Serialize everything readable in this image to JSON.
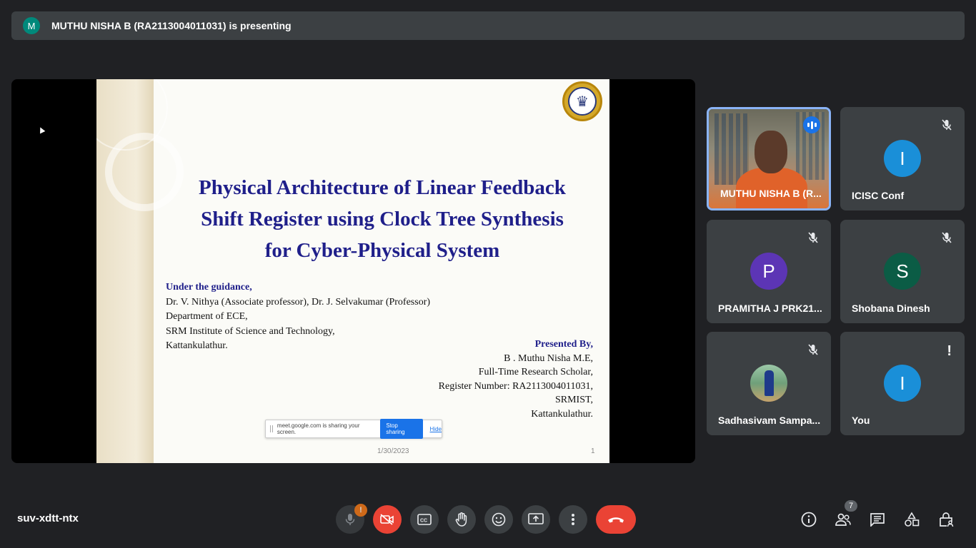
{
  "banner": {
    "avatar_letter": "M",
    "text": "MUTHU NISHA B (RA2113004011031) is presenting"
  },
  "slide": {
    "title_lines": [
      "Physical Architecture of Linear Feedback",
      "Shift Register using Clock Tree Synthesis",
      "for Cyber-Physical System"
    ],
    "guidance": {
      "heading": "Under the guidance,",
      "lines": [
        "Dr. V. Nithya (Associate professor), Dr. J. Selvakumar (Professor)",
        "Department of ECE,",
        "SRM Institute of Science and Technology,",
        "Kattankulathur."
      ]
    },
    "presenter": {
      "heading": "Presented By,",
      "lines": [
        "B . Muthu Nisha M.E,",
        "Full-Time Research Scholar,",
        "Register Number: RA2113004011031,",
        "SRMIST,",
        "Kattankulathur."
      ]
    },
    "share_bar": {
      "text": "meet.google.com is sharing your screen.",
      "stop_label": "Stop sharing",
      "hide_label": "Hide"
    },
    "date": "1/30/2023",
    "page": "1"
  },
  "participants": [
    {
      "name": "MUTHU NISHA B (R...",
      "type": "video",
      "speaking": true
    },
    {
      "name": "ICISC Conf",
      "letter": "I",
      "color": "#1a8fd8",
      "muted": true
    },
    {
      "name": "PRAMITHA J PRK21...",
      "letter": "P",
      "color": "#5c35b5",
      "muted": true
    },
    {
      "name": "Shobana Dinesh",
      "letter": "S",
      "color": "#0b5c45",
      "muted": true
    },
    {
      "name": "Sadhasivam Sampa...",
      "type": "photo",
      "muted": true
    },
    {
      "name": "You",
      "letter": "I",
      "color": "#1a8fd8",
      "warning": "!"
    }
  ],
  "footer": {
    "meeting_code": "suv-xdtt-ntx",
    "mic_alert": "!",
    "people_count": "7"
  },
  "colors": {
    "background": "#202124",
    "tile": "#3c4043",
    "danger": "#ea4335",
    "accent": "#1a73e8"
  }
}
